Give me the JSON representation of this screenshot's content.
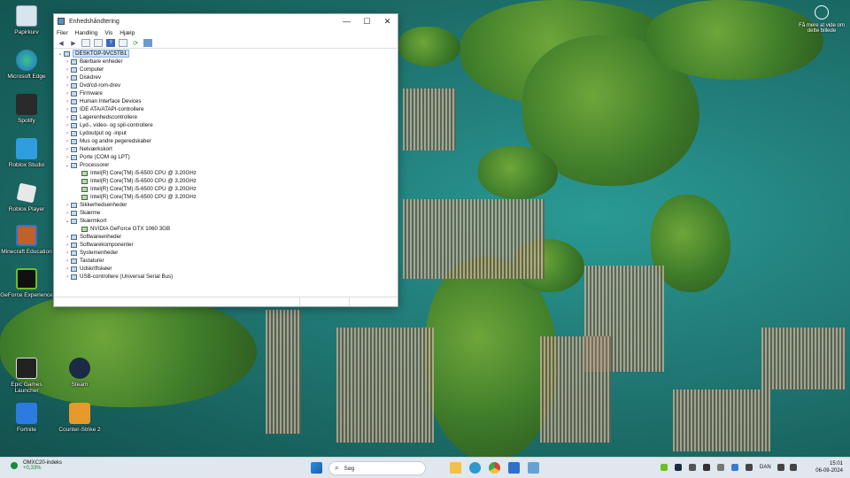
{
  "desktop": {
    "icons": [
      {
        "label": "Papirkurv"
      },
      {
        "label": "Microsoft Edge"
      },
      {
        "label": "Spotify"
      },
      {
        "label": "Roblox Studio"
      },
      {
        "label": "Roblox Player"
      },
      {
        "label": "Minecraft Education"
      },
      {
        "label": "GeForce Experience"
      },
      {
        "label": "Epic Games Launcher"
      },
      {
        "label": "Steam"
      },
      {
        "label": "Fortnite"
      },
      {
        "label": "Counter-Strike 2"
      }
    ],
    "spotlight_label": "Få mere at vide om dette billede"
  },
  "window": {
    "title": "Enhedshåndtering",
    "controls": {
      "minimize": "—",
      "maximize": "☐",
      "close": "✕"
    },
    "menu": [
      "Filer",
      "Handling",
      "Vis",
      "Hjælp"
    ],
    "tree": {
      "root": "DESKTOP-9VC5TB1",
      "items": [
        {
          "label": "Bærbare enheder",
          "expanded": false
        },
        {
          "label": "Computer",
          "expanded": false
        },
        {
          "label": "Diskdrev",
          "expanded": false
        },
        {
          "label": "Dvd/cd-rom-drev",
          "expanded": false
        },
        {
          "label": "Firmware",
          "expanded": false
        },
        {
          "label": "Human Interface Devices",
          "expanded": false
        },
        {
          "label": "IDE ATA/ATAPI-controllere",
          "expanded": false
        },
        {
          "label": "Lagerenhedscontrollere",
          "expanded": false
        },
        {
          "label": "Lyd-, video- og spil-controllere",
          "expanded": false
        },
        {
          "label": "Lydoutput og -input",
          "expanded": false
        },
        {
          "label": "Mus og andre pegeredskaber",
          "expanded": false
        },
        {
          "label": "Netværkskort",
          "expanded": false
        },
        {
          "label": "Porte (COM og LPT)",
          "expanded": false
        },
        {
          "label": "Processorer",
          "expanded": true,
          "children": [
            "Intel(R) Core(TM) i5-6500 CPU @ 3.20GHz",
            "Intel(R) Core(TM) i5-6500 CPU @ 3.20GHz",
            "Intel(R) Core(TM) i5-6500 CPU @ 3.20GHz",
            "Intel(R) Core(TM) i5-6500 CPU @ 3.20GHz"
          ]
        },
        {
          "label": "Sikkerhedsenheder",
          "expanded": false
        },
        {
          "label": "Skærme",
          "expanded": false
        },
        {
          "label": "Skærmkort",
          "expanded": true,
          "children": [
            "NVIDIA GeForce GTX 1060 3GB"
          ]
        },
        {
          "label": "Softwareenheder",
          "expanded": false
        },
        {
          "label": "Softwarekomponenter",
          "expanded": false
        },
        {
          "label": "Systemenheder",
          "expanded": false
        },
        {
          "label": "Tastaturer",
          "expanded": false
        },
        {
          "label": "Udskriftskøer",
          "expanded": false
        },
        {
          "label": "USB-controllere (Universal Serial Bus)",
          "expanded": false
        }
      ]
    }
  },
  "taskbar": {
    "stock_name": "OMXC20-indeks",
    "stock_change": "+0,33%",
    "search_placeholder": "Søg",
    "language": "DAN",
    "time": "15:01",
    "date": "06-09-2024"
  }
}
